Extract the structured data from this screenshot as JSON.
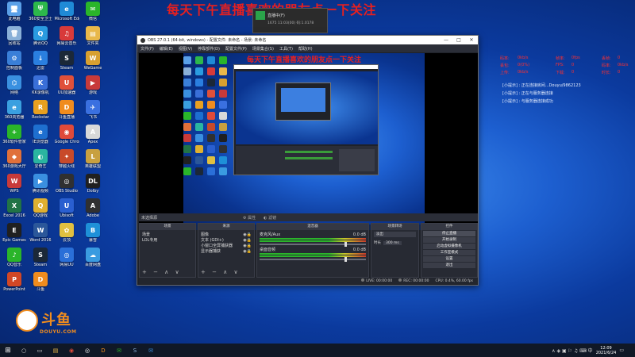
{
  "stream_overlay_title": "每天下午直播喜欢的朋友点一下关注",
  "popup": {
    "line1": "直播中(F)",
    "line2": "1675 11:03(00) 码:1.0178"
  },
  "desktop_icons": [
    {
      "label": "此电脑",
      "color": "#5aa0e8",
      "glyph": "🖥"
    },
    {
      "label": "360安全卫士",
      "color": "#2db84b",
      "glyph": "⛨"
    },
    {
      "label": "Microsoft Edge",
      "color": "#1f8ad6",
      "glyph": "e"
    },
    {
      "label": "微信",
      "color": "#2ab52a",
      "glyph": "✉"
    },
    {
      "label": "回收站",
      "color": "#8ab0d8",
      "glyph": "🗑"
    },
    {
      "label": "腾讯QQ",
      "color": "#2a9be0",
      "glyph": "Q"
    },
    {
      "label": "网易云音乐",
      "color": "#d83a3a",
      "glyph": "♫"
    },
    {
      "label": "文件夹",
      "color": "#e8b84a",
      "glyph": "▤"
    },
    {
      "label": "控制面板",
      "color": "#3a7fd8",
      "glyph": "⚙"
    },
    {
      "label": "迅雷",
      "color": "#2a7fe0",
      "glyph": "↓"
    },
    {
      "label": "Steam",
      "color": "#1b2838",
      "glyph": "S"
    },
    {
      "label": "WeGame",
      "color": "#d8a030",
      "glyph": "W"
    },
    {
      "label": "网络",
      "color": "#3a90e0",
      "glyph": "⌬"
    },
    {
      "label": "KK录像机",
      "color": "#3a6fd8",
      "glyph": "K"
    },
    {
      "label": "UU加速器",
      "color": "#e0503a",
      "glyph": "U"
    },
    {
      "label": "游戏",
      "color": "#c83a3a",
      "glyph": "▶"
    },
    {
      "label": "360浏览器",
      "color": "#3aa0e0",
      "glyph": "e"
    },
    {
      "label": "Rockstar",
      "color": "#e8a020",
      "glyph": "R"
    },
    {
      "label": "斗鱼直播",
      "color": "#f08c1e",
      "glyph": "D"
    },
    {
      "label": "飞书",
      "color": "#3a70e0",
      "glyph": "✈"
    },
    {
      "label": "360软件管家",
      "color": "#2ab52a",
      "glyph": "+"
    },
    {
      "label": "IE浏览器",
      "color": "#1e6fd0",
      "glyph": "e"
    },
    {
      "label": "Google Chrome",
      "color": "#e04a3a",
      "glyph": "◉"
    },
    {
      "label": "Apex",
      "color": "#d8d8d8",
      "glyph": "A"
    },
    {
      "label": "360游戏大厅",
      "color": "#e0703a",
      "glyph": "◆"
    },
    {
      "label": "爱奇艺",
      "color": "#2ab5a0",
      "glyph": "◐"
    },
    {
      "label": "穿越火线",
      "color": "#c84a2a",
      "glyph": "✦"
    },
    {
      "label": "英雄联盟",
      "color": "#c8a040",
      "glyph": "L"
    },
    {
      "label": "WPS",
      "color": "#c83a3a",
      "glyph": "W"
    },
    {
      "label": "腾讯视频",
      "color": "#3a8fe0",
      "glyph": "▶"
    },
    {
      "label": "OBS Studio",
      "color": "#303030",
      "glyph": "◎"
    },
    {
      "label": "Dolby",
      "color": "#202020",
      "glyph": "DL"
    },
    {
      "label": "Excel 2016",
      "color": "#217346",
      "glyph": "X"
    },
    {
      "label": "QQ游戏",
      "color": "#e0b030",
      "glyph": "Q"
    },
    {
      "label": "Ubisoft",
      "color": "#2a5fd0",
      "glyph": "U"
    },
    {
      "label": "Adobe",
      "color": "#303030",
      "glyph": "A"
    },
    {
      "label": "Epic Games",
      "color": "#202020",
      "glyph": "E"
    },
    {
      "label": "Word 2016",
      "color": "#2b579a",
      "glyph": "W"
    },
    {
      "label": "云顶",
      "color": "#e0c040",
      "glyph": "✿"
    },
    {
      "label": "暴雪",
      "color": "#1e90d8",
      "glyph": "B"
    },
    {
      "label": "QQ音乐",
      "color": "#2ab52a",
      "glyph": "♪"
    },
    {
      "label": "Steam",
      "color": "#1b2838",
      "glyph": "S"
    },
    {
      "label": "网易UU",
      "color": "#2a6fd8",
      "glyph": "◎"
    },
    {
      "label": "百度网盘",
      "color": "#3a9be0",
      "glyph": "☁"
    },
    {
      "label": "PowerPoint",
      "color": "#d24726",
      "glyph": "P"
    },
    {
      "label": "斗鱼",
      "color": "#f08c1e",
      "glyph": "D"
    }
  ],
  "obs": {
    "title": "OBS 27.0.1 (64-bit, windows) - 配置文件: 未命名 - 场景: 未命名",
    "window_controls": [
      "—",
      "□",
      "✕"
    ],
    "menu": [
      "文件(F)",
      "编辑(E)",
      "视图(V)",
      "停靠部件(D)",
      "配置文件(P)",
      "场景集合(S)",
      "工具(T)",
      "帮助(H)"
    ],
    "preview_title": "每天下午直播喜欢的朋友点一下关注",
    "source_toolbar": "未选择源",
    "properties_label": "属性",
    "filters_label": "滤镜",
    "scenes": {
      "header": "场景",
      "items": [
        "场景",
        "LOL专用"
      ]
    },
    "sources": {
      "header": "来源",
      "items": [
        "图像",
        "文本 (GDI+)",
        "小窗口全屏捕获器",
        "显示器捕获"
      ]
    },
    "mixer": {
      "header": "混音器",
      "channels": [
        {
          "name": "麦克风/Aux",
          "db": "0.0 dB"
        },
        {
          "name": "桌面音频",
          "db": "0.0 dB"
        }
      ]
    },
    "transitions": {
      "header": "场景转场",
      "type": "淡出",
      "duration_label": "时长",
      "duration_value": "300 ms"
    },
    "controls": {
      "header": "控件",
      "buttons": [
        "停止直播",
        "开始录制",
        "启动虚拟摄像机",
        "工作室模式",
        "设置",
        "退出"
      ]
    },
    "dock_footer": "+ − ∧ ∨",
    "status": {
      "live": "LIVE: 00:00:00",
      "rec": "REC: 00:00:00",
      "cpu": "CPU: 0.4%, 60.00 fps"
    }
  },
  "stats": [
    {
      "label": "码率:",
      "value": "0kb/s",
      "label2": "帧率:",
      "value2": "0fps",
      "label3": "丢帧:",
      "value3": "0"
    },
    {
      "label": "丢包:",
      "value": "0(0%)",
      "label2": "FPS:",
      "value2": "0",
      "label3": "码率:",
      "value3": "0kb/s"
    },
    {
      "label": "上传:",
      "value": "0kb/s",
      "label2": "下载:",
      "value2": "0",
      "label3": "时长:",
      "value3": "0"
    }
  ],
  "log": [
    "[小提示] : 正在连接房间...Douyu/9862123",
    "[小提示] : 正在与服务器连接",
    "[小提示] : 与服务器连接成功"
  ],
  "douyu": {
    "name": "斗鱼",
    "url": "DOUYU.COM"
  },
  "taskbar": {
    "start_glyph": "⊞",
    "apps": [
      {
        "name": "search",
        "glyph": "○",
        "color": "#ddd"
      },
      {
        "name": "task-view",
        "glyph": "▭",
        "color": "#ddd"
      },
      {
        "name": "file-explorer",
        "glyph": "▤",
        "color": "#e8b84a"
      },
      {
        "name": "chrome",
        "glyph": "◉",
        "color": "#e04a3a"
      },
      {
        "name": "obs",
        "glyph": "◎",
        "color": "#fff"
      },
      {
        "name": "douyu",
        "glyph": "D",
        "color": "#f08c1e"
      },
      {
        "name": "wechat",
        "glyph": "✉",
        "color": "#2ab52a"
      },
      {
        "name": "steam",
        "glyph": "S",
        "color": "#8ab0d8"
      },
      {
        "name": "mail",
        "glyph": "✉",
        "color": "#3a8fe0"
      }
    ],
    "time": "12:09",
    "date": "2021/6/24"
  }
}
